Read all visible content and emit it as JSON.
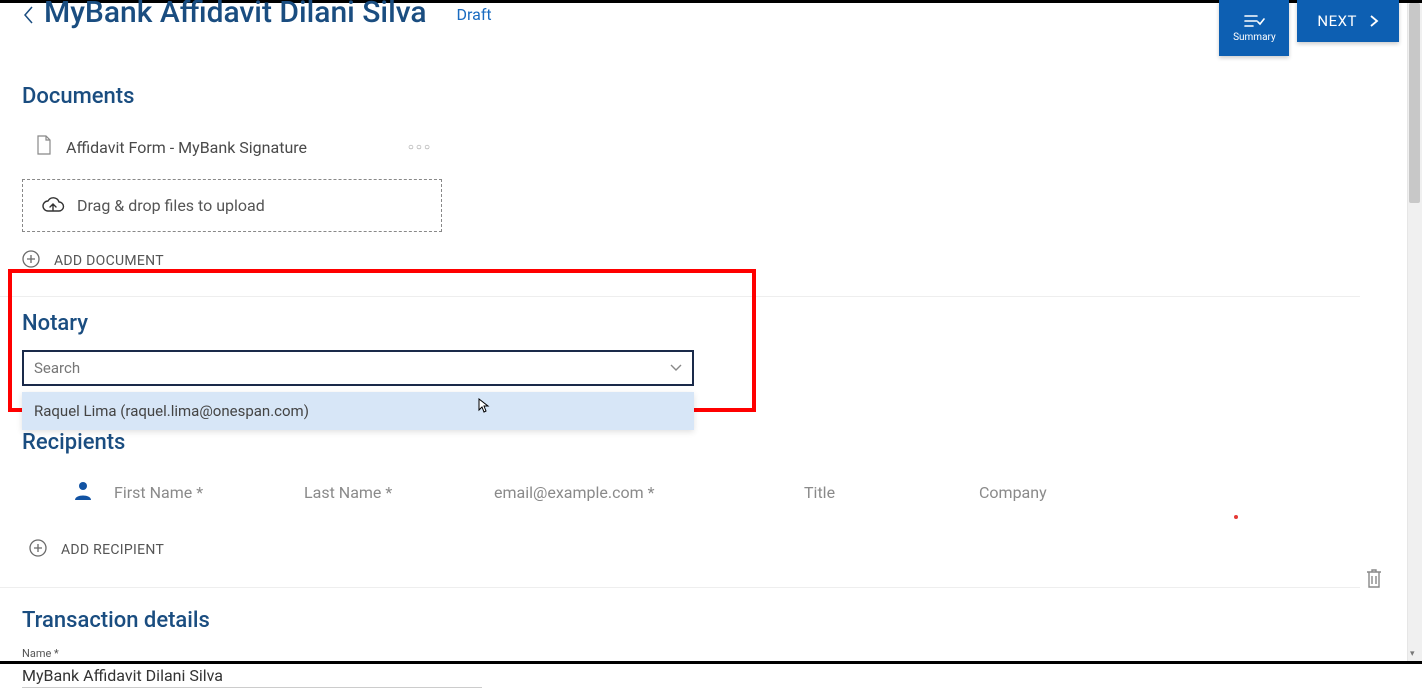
{
  "header": {
    "title": "MyBank Affidavit Dilani Silva",
    "status": "Draft",
    "summary_label": "Summary",
    "next_label": "NEXT"
  },
  "documents": {
    "heading": "Documents",
    "items": [
      {
        "name": "Affidavit Form - MyBank Signature"
      }
    ],
    "drop_hint": "Drag & drop files to upload",
    "add_label": "ADD DOCUMENT"
  },
  "notary": {
    "heading": "Notary",
    "search_placeholder": "Search",
    "options": [
      {
        "label": "Raquel Lima (raquel.lima@onespan.com)"
      }
    ]
  },
  "recipients": {
    "heading": "Recipients",
    "placeholders": {
      "first_name": "First Name *",
      "last_name": "Last Name *",
      "email": "email@example.com *",
      "title": "Title",
      "company": "Company"
    },
    "add_label": "ADD RECIPIENT"
  },
  "transaction": {
    "heading": "Transaction details",
    "name_label": "Name *",
    "name_value": "MyBank Affidavit Dilani Silva"
  }
}
